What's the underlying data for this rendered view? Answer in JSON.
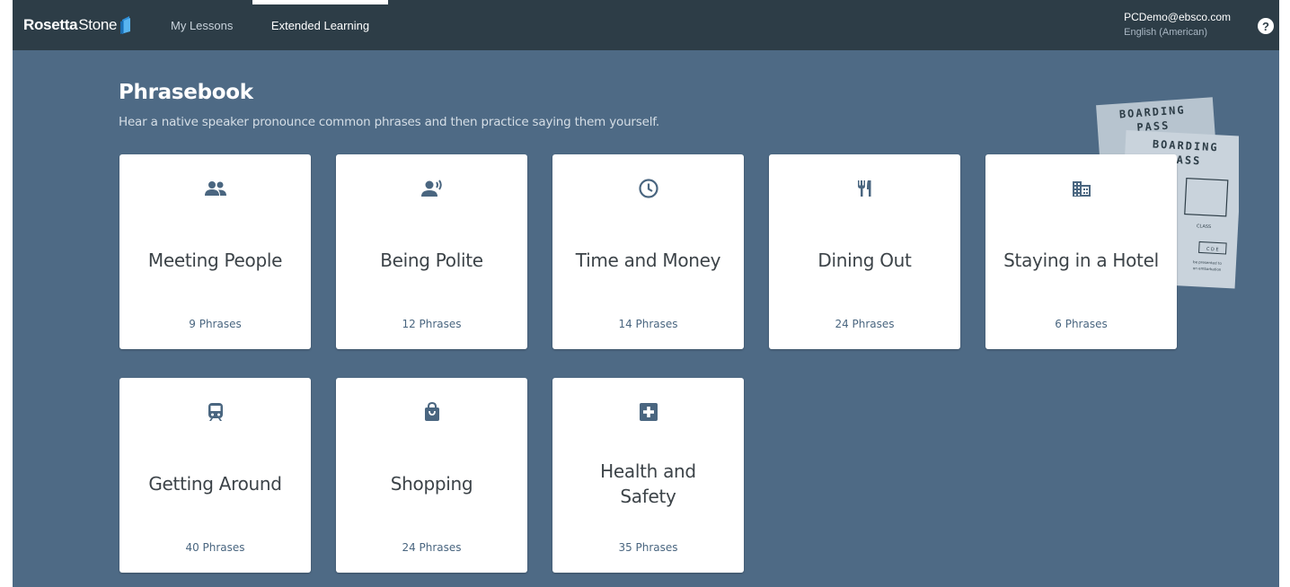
{
  "header": {
    "logo_bold": "Rosetta",
    "logo_light": "Stone",
    "nav": [
      {
        "label": "My Lessons",
        "active": false
      },
      {
        "label": "Extended Learning",
        "active": true
      }
    ],
    "account_email": "PCDemo@ebsco.com",
    "account_language": "English (American)",
    "help_label": "?"
  },
  "page": {
    "title": "Phrasebook",
    "subtitle": "Hear a native speaker pronounce common phrases and then practice saying them yourself."
  },
  "decoration": {
    "pass_text_1": "BOARDING",
    "pass_text_2": "PASS",
    "pass_text_3": "BOARDING",
    "pass_text_4": "PASS",
    "pass_small_1": "CLASS",
    "pass_small_2": "C D E",
    "pass_small_3": "be presented to",
    "pass_small_4": "on embarkation"
  },
  "cards": [
    {
      "name": "Meeting People",
      "count": "9 Phrases",
      "icon": "people-icon"
    },
    {
      "name": "Being Polite",
      "count": "12 Phrases",
      "icon": "speaking-person-icon"
    },
    {
      "name": "Time and Money",
      "count": "14 Phrases",
      "icon": "clock-icon"
    },
    {
      "name": "Dining Out",
      "count": "24 Phrases",
      "icon": "utensils-icon"
    },
    {
      "name": "Staying in a Hotel",
      "count": "6 Phrases",
      "icon": "building-icon"
    },
    {
      "name": "Getting Around",
      "count": "40 Phrases",
      "icon": "train-icon"
    },
    {
      "name": "Shopping",
      "count": "24 Phrases",
      "icon": "shopping-bag-icon"
    },
    {
      "name": "Health and Safety",
      "count": "35 Phrases",
      "icon": "medical-cross-icon"
    }
  ],
  "colors": {
    "topbar": "#2d3d47",
    "background": "#4e6a85",
    "icon": "#4a6680"
  }
}
